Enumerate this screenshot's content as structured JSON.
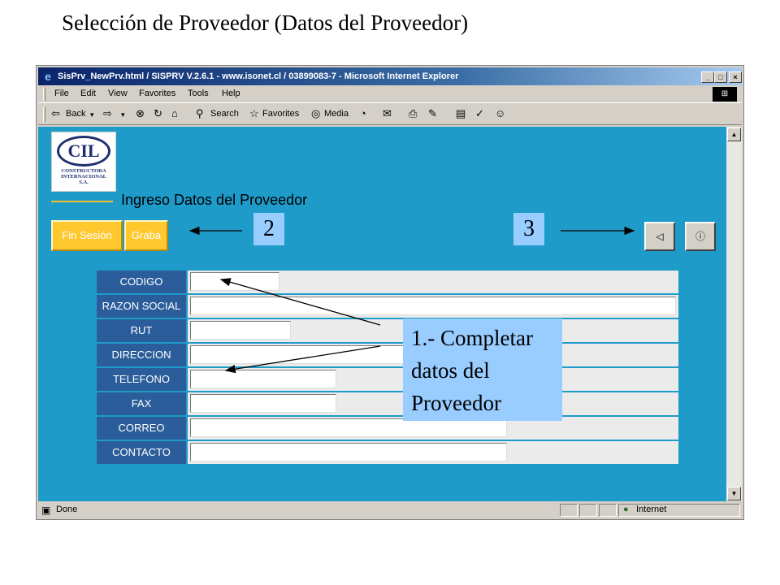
{
  "slide": {
    "title": "Selección de Proveedor (Datos del Proveedor)"
  },
  "window": {
    "title": "SisPrv_NewPrv.html / SISPRV V.2.6.1 - www.isonet.cl / 03899083-7 - Microsoft Internet Explorer",
    "minimize": "_",
    "maximize": "□",
    "close": "×"
  },
  "menu": {
    "items": [
      "File",
      "Edit",
      "View",
      "Favorites",
      "Tools",
      "Help"
    ]
  },
  "toolbar": {
    "back": "Back",
    "search": "Search",
    "favorites": "Favorites",
    "media": "Media"
  },
  "status": {
    "left": "Done",
    "zone": "Internet"
  },
  "logo": {
    "initials": "CIL",
    "line1": "CONSTRUCTORA",
    "line2": "INTERNACIONAL",
    "line3": "S.A."
  },
  "page": {
    "heading": "Ingreso Datos del Proveedor"
  },
  "buttons": {
    "logout": "Fin Sesión",
    "save": "Graba",
    "back_glyph": "◁",
    "info_glyph": "ⓘ"
  },
  "form": {
    "rows": [
      {
        "label": "CODIGO",
        "value": ""
      },
      {
        "label": "RAZON SOCIAL",
        "value": ""
      },
      {
        "label": "RUT",
        "value": ""
      },
      {
        "label": "DIRECCION",
        "value": ""
      },
      {
        "label": "TELEFONO",
        "value": ""
      },
      {
        "label": "FAX",
        "value": ""
      },
      {
        "label": "CORREO",
        "value": ""
      },
      {
        "label": "CONTACTO",
        "value": ""
      }
    ]
  },
  "annotations": {
    "callout_lines": [
      "1.- Completar",
      "datos del",
      "Proveedor"
    ],
    "num2": "2",
    "num3": "3"
  }
}
